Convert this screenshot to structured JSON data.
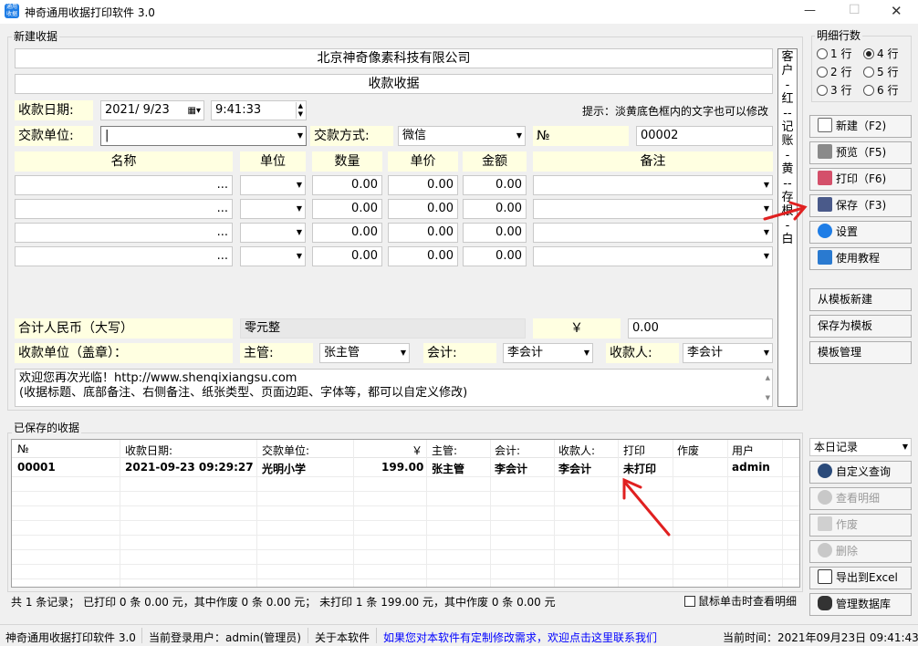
{
  "app": {
    "title": "神奇通用收据打印软件 3.0",
    "icon_text": "通用收据"
  },
  "titlebar": {
    "minimize": "—",
    "maximize": "☐",
    "close": "✕"
  },
  "form": {
    "group_label": "新建收据",
    "company": "北京神奇像素科技有限公司",
    "receipt_title": "收款收据",
    "date_label": "收款日期:",
    "date_value": "2021/ 9/23",
    "time_value": "9:41:33",
    "tip": "提示：淡黄底色框内的文字也可以修改",
    "payer_label": "交款单位:",
    "payer_value": "",
    "method_label": "交款方式:",
    "method_value": "微信",
    "no_label": "№",
    "no_value": "00002",
    "headers": {
      "name": "名称",
      "unit": "单位",
      "qty": "数量",
      "price": "单价",
      "amount": "金额",
      "remark": "备注"
    },
    "rows": [
      {
        "name_btn": "...",
        "unit": "",
        "qty": "0.00",
        "price": "0.00",
        "amount": "0.00",
        "remark": ""
      },
      {
        "name_btn": "...",
        "unit": "",
        "qty": "0.00",
        "price": "0.00",
        "amount": "0.00",
        "remark": ""
      },
      {
        "name_btn": "...",
        "unit": "",
        "qty": "0.00",
        "price": "0.00",
        "amount": "0.00",
        "remark": ""
      },
      {
        "name_btn": "...",
        "unit": "",
        "qty": "0.00",
        "price": "0.00",
        "amount": "0.00",
        "remark": ""
      }
    ],
    "total_cn_label": "合计人民币（大写）",
    "total_cn_value": "零元整",
    "yen_label": "￥",
    "total_value": "0.00",
    "seal_label": "收款单位（盖章）：",
    "supervisor_label": "主管:",
    "supervisor_value": "张主管",
    "accountant_label": "会计:",
    "accountant_value": "李会计",
    "cashier_label": "收款人:",
    "cashier_value": "李会计",
    "footer_line1": "欢迎您再次光临！http://www.shenqixiangsu.com",
    "footer_line2": "(收据标题、底部备注、右侧备注、纸张类型、页面边距、字体等，都可以自定义修改)",
    "side_note": [
      "客",
      "户",
      "-",
      "红",
      "--",
      "记",
      "账",
      "-",
      "黄",
      "--",
      "存",
      "根",
      "-",
      "白"
    ]
  },
  "detail_rows": {
    "label": "明细行数",
    "options": [
      "1 行",
      "2 行",
      "3 行",
      "4 行",
      "5 行",
      "6 行"
    ],
    "selected": "4 行"
  },
  "buttons": {
    "new": "新建（F2)",
    "preview": "预览（F5)",
    "print": "打印（F6)",
    "save": "保存（F3)",
    "settings": "设置",
    "tutorial": "使用教程",
    "from_template": "从模板新建",
    "save_template": "保存为模板",
    "manage_template": "模板管理"
  },
  "saved": {
    "group_label": "已保存的收据",
    "columns": [
      "№",
      "收款日期:",
      "交款单位:",
      "￥",
      "主管:",
      "会计:",
      "收款人:",
      "打印",
      "作废",
      "用户"
    ],
    "rows": [
      {
        "no": "00001",
        "date": "2021-09-23 09:29:27",
        "payer": "光明小学",
        "amount": "199.00",
        "supervisor": "张主管",
        "accountant": "李会计",
        "cashier": "李会计",
        "print": "未打印",
        "void": "",
        "user": "admin"
      }
    ],
    "filter": "本日记录",
    "btn_query": "自定义查询",
    "btn_view": "查看明细",
    "btn_void": "作废",
    "btn_delete": "删除",
    "btn_excel": "导出到Excel",
    "btn_db": "管理数据库",
    "summary": "共 1 条记录；   已打印 0 条 0.00 元，其中作废 0 条 0.00 元；   未打印 1 条 199.00 元，其中作废 0 条 0.00 元",
    "click_option": "鼠标单击时查看明细"
  },
  "status": {
    "app": "神奇通用收据打印软件 3.0",
    "user": "当前登录用户：admin(管理员)",
    "about": "关于本软件",
    "link": "如果您对本软件有定制修改需求，欢迎点击这里联系我们",
    "time": "当前时间：2021年09月23日 09:41:43"
  },
  "colors": {
    "yellow_field": "#ffffe1",
    "link": "#0000ff",
    "arrow": "#e02020",
    "accent": "#1e7de6"
  }
}
